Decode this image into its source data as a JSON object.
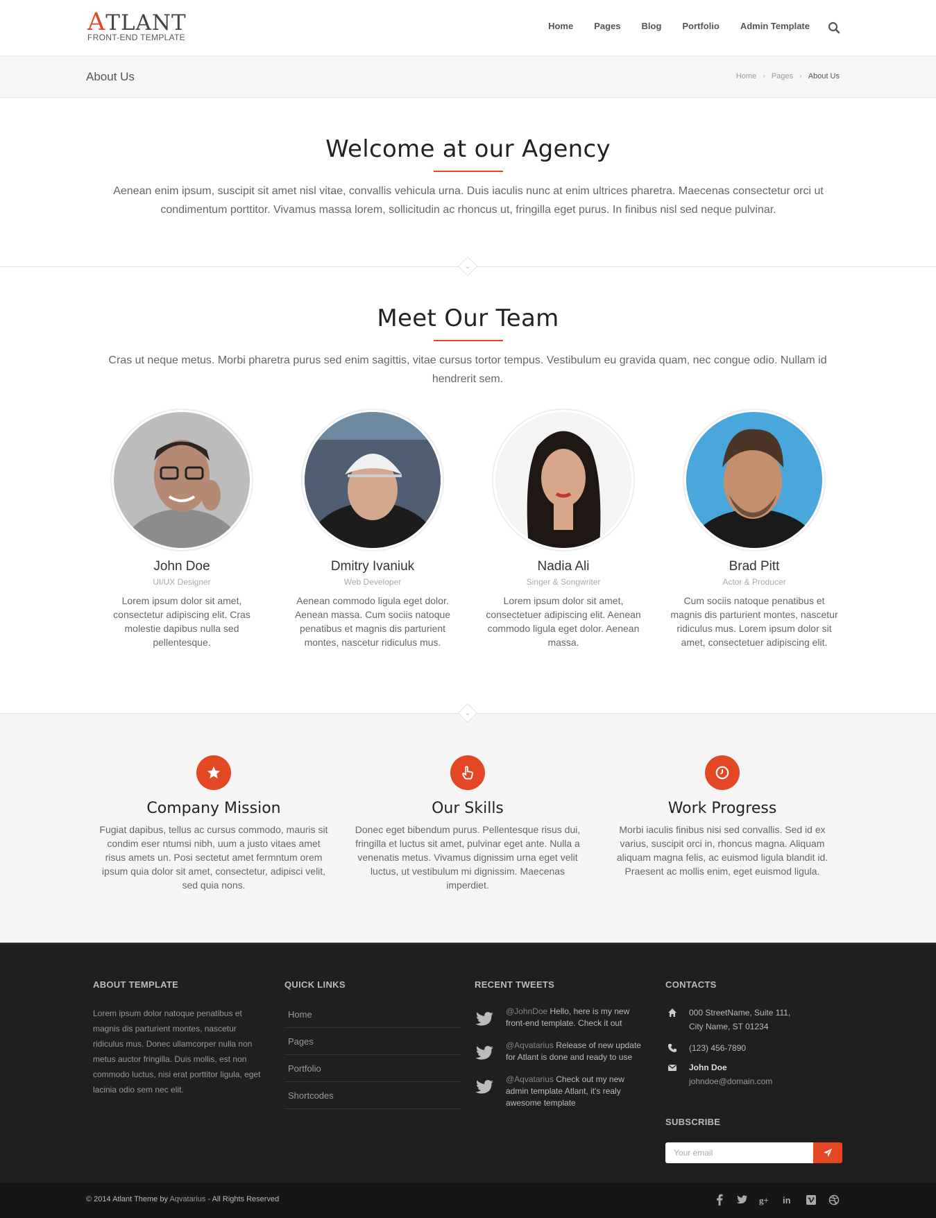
{
  "brand": {
    "logo_first": "A",
    "logo_rest": "TLANT",
    "logo_tagline": "FRONT-END TEMPLATE"
  },
  "nav": {
    "items": [
      "Home",
      "Pages",
      "Blog",
      "Portfolio",
      "Admin Template"
    ],
    "search_icon": "search-icon"
  },
  "titlebar": {
    "title": "About Us",
    "crumbs": [
      "Home",
      "Pages",
      "About Us"
    ]
  },
  "welcome": {
    "title": "Welcome at our Agency",
    "text": "Aenean enim ipsum, suscipit sit amet nisl vitae, convallis vehicula urna. Duis iaculis nunc at enim ultrices pharetra. Maecenas consectetur orci ut condimentum porttitor. Vivamus massa lorem, sollicitudin ac rhoncus ut, fringilla eget purus. In finibus nisl sed neque pulvinar."
  },
  "team": {
    "title": "Meet Our Team",
    "text": "Cras ut neque metus. Morbi pharetra purus sed enim sagittis, vitae cursus tortor tempus. Vestibulum eu gravida quam, nec congue odio. Nullam id hendrerit sem.",
    "members": [
      {
        "name": "John Doe",
        "role": "UI/UX Designer",
        "bio": "Lorem ipsum dolor sit amet, consectetur adipiscing elit. Cras molestie dapibus nulla sed pellentesque."
      },
      {
        "name": "Dmitry Ivaniuk",
        "role": "Web Developer",
        "bio": "Aenean commodo ligula eget dolor. Aenean massa. Cum sociis natoque penatibus et magnis dis parturient montes, nascetur ridiculus mus."
      },
      {
        "name": "Nadia Ali",
        "role": "Singer & Songwriter",
        "bio": "Lorem ipsum dolor sit amet, consectetuer adipiscing elit. Aenean commodo ligula eget dolor. Aenean massa."
      },
      {
        "name": "Brad Pitt",
        "role": "Actor & Producer",
        "bio": "Cum sociis natoque penatibus et magnis dis parturient montes, nascetur ridiculus mus. Lorem ipsum dolor sit amet, consectetuer adipiscing elit."
      }
    ]
  },
  "features": [
    {
      "icon": "star-icon",
      "title": "Company Mission",
      "text": "Fugiat dapibus, tellus ac cursus commodo, mauris sit condim eser ntumsi nibh, uum a justo vitaes amet risus amets un. Posi sectetut amet fermntum orem ipsum quia dolor sit amet, consectetur, adipisci velit, sed quia nons."
    },
    {
      "icon": "hand-pointer-icon",
      "title": "Our Skills",
      "text": "Donec eget bibendum purus. Pellentesque risus dui, fringilla et luctus sit amet, pulvinar eget ante. Nulla a venenatis metus. Vivamus dignissim urna eget velit luctus, ut vestibulum mi dignissim. Maecenas imperdiet."
    },
    {
      "icon": "clock-icon",
      "title": "Work Progress",
      "text": "Morbi iaculis finibus nisi sed convallis. Sed id ex varius, suscipit orci in, rhoncus magna. Aliquam aliquam magna felis, ac euismod ligula blandit id. Praesent ac mollis enim, eget euismod ligula."
    }
  ],
  "footer": {
    "about": {
      "heading": "ABOUT TEMPLATE",
      "text": "Lorem ipsum dolor natoque penatibus et magnis dis parturient montes, nascetur ridiculus mus. Donec ullamcorper nulla non metus auctor fringilla. Duis mollis, est non commodo luctus, nisi erat porttitor ligula, eget lacinia odio sem nec elit."
    },
    "links": {
      "heading": "QUICK LINKS",
      "items": [
        "Home",
        "Pages",
        "Portfolio",
        "Shortcodes"
      ]
    },
    "tweets": {
      "heading": "RECENT TWEETS",
      "items": [
        {
          "handle": "@JohnDoe",
          "text": " Hello, here is my new front-end template. Check it out"
        },
        {
          "handle": "@Aqvatarius",
          "text": " Release of new update for Atlant is done and ready to use"
        },
        {
          "handle": "@Aqvatarius",
          "text": " Check out my new admin template Atlant, it's realy awesome template"
        }
      ]
    },
    "contacts": {
      "heading": "CONTACTS",
      "address_line1": "000 StreetName, Suite 111,",
      "address_line2": "City Name, ST 01234",
      "phone": "(123) 456-7890",
      "name": "John Doe",
      "email": "johndoe@domain.com"
    },
    "subscribe": {
      "heading": "SUBSCRIBE",
      "placeholder": "Your email"
    }
  },
  "bottom": {
    "copyright_prefix": "© 2014 Atlant Theme by ",
    "copyright_brand": "Aqvatarius",
    "copyright_suffix": " - All Rights Reserved",
    "socials": [
      "facebook-icon",
      "twitter-icon",
      "google-plus-icon",
      "linkedin-icon",
      "vimeo-icon",
      "dribbble-icon"
    ]
  },
  "colors": {
    "accent": "#e34724",
    "footer_bg": "#1f1f1f",
    "bottom_bg": "#161616",
    "section_bg": "#f5f5f5"
  }
}
